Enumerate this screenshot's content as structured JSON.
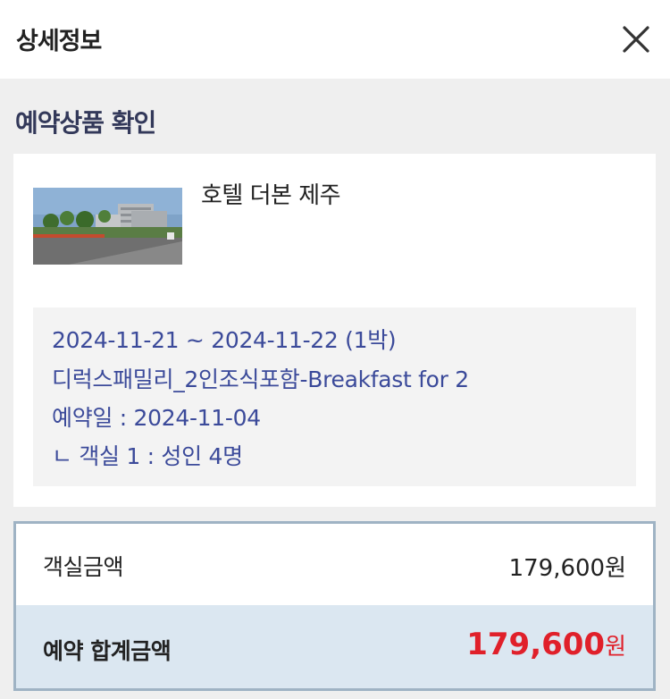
{
  "header": {
    "title": "상세정보",
    "close_icon": "close-icon"
  },
  "section": {
    "title": "예약상품 확인"
  },
  "product": {
    "hotel_name": "호텔 더본 제주",
    "thumbnail_icon": "hotel-photo"
  },
  "details": {
    "dates": "2024-11-21 ~ 2024-11-22 (1박)",
    "room_type": "디럭스패밀리_2인조식포함-Breakfast for 2",
    "booking_date": "예약일 : 2024-11-04",
    "guests": "ㄴ 객실 1 : 성인 4명"
  },
  "pricing": {
    "room_price_label": "객실금액",
    "room_price_value": "179,600원",
    "total_label": "예약 합계금액",
    "total_amount": "179,600",
    "total_unit": "원",
    "total_color": "#e0202a"
  }
}
